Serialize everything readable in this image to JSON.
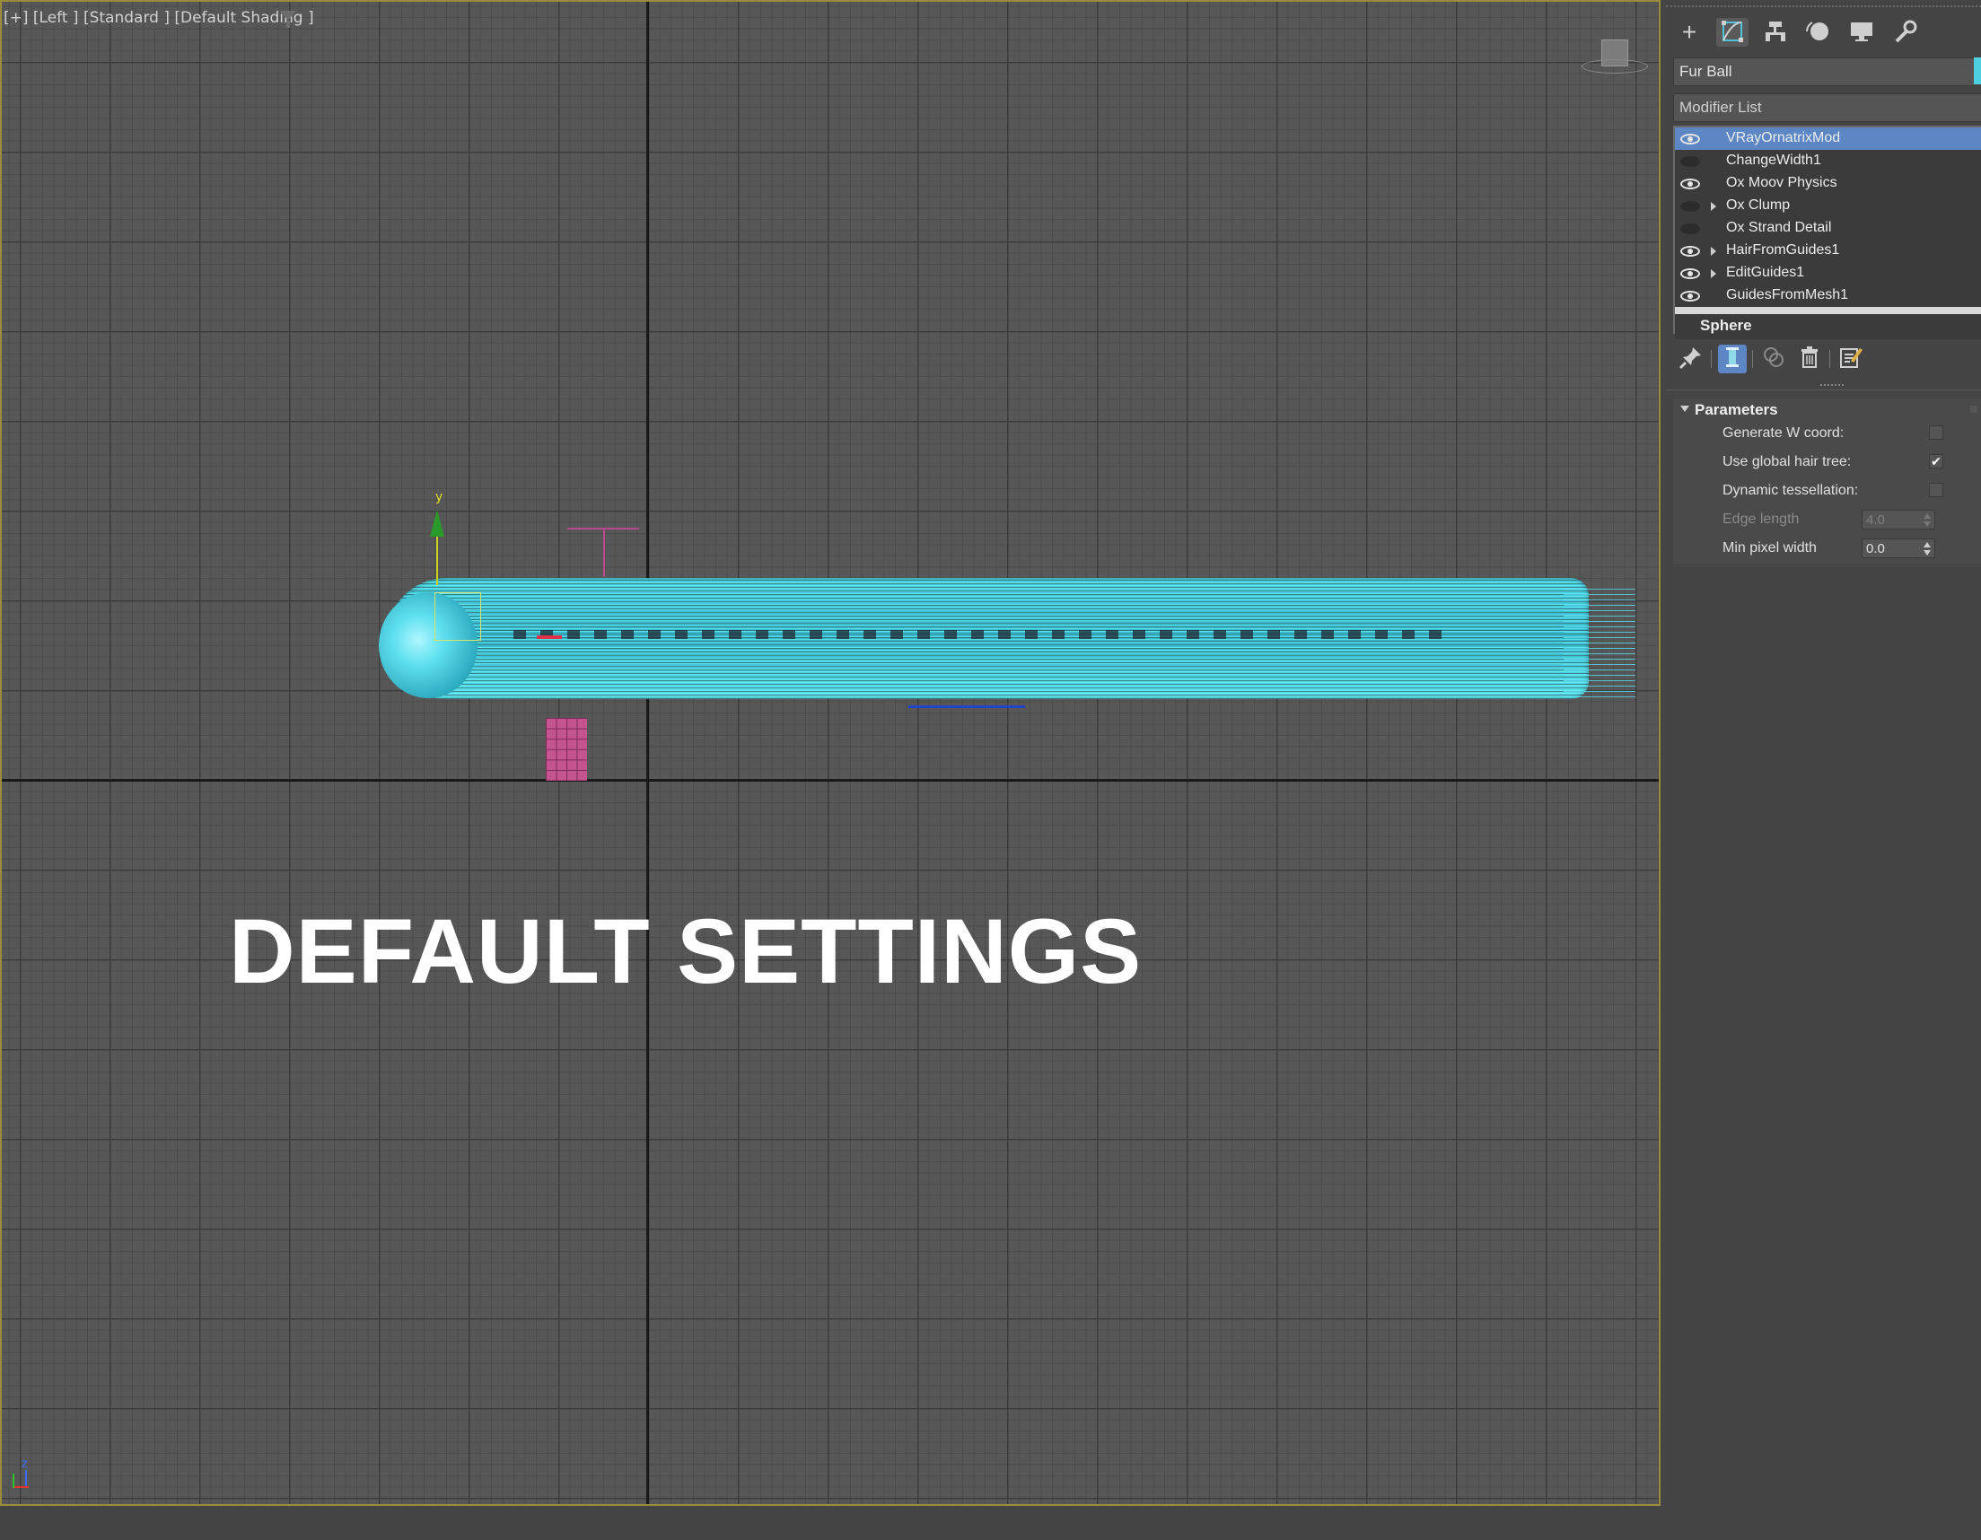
{
  "viewport": {
    "label": "[+] [Left ] [Standard ] [Default Shading ]",
    "overlay_text": "DEFAULT SETTINGS",
    "gizmo_axis_label": "y",
    "world_axis_label": "z"
  },
  "command_panel": {
    "tabs": [
      {
        "name": "create",
        "glyph": "+"
      },
      {
        "name": "modify",
        "glyph": "⬚",
        "active": true
      },
      {
        "name": "hierarchy",
        "glyph": "⊤"
      },
      {
        "name": "motion",
        "glyph": "●"
      },
      {
        "name": "display",
        "glyph": "▬"
      },
      {
        "name": "utilities",
        "glyph": "🔧"
      }
    ],
    "object_name": "Fur Ball",
    "object_color": "#4fd0e0",
    "modifier_list_label": "Modifier List",
    "stack": [
      {
        "label": "VRayOrnatrixMod",
        "eye": true,
        "expandable": false,
        "selected": true
      },
      {
        "label": "ChangeWidth1",
        "eye": false,
        "expandable": false
      },
      {
        "label": "Ox Moov Physics",
        "eye": true,
        "expandable": false
      },
      {
        "label": "Ox Clump",
        "eye": false,
        "expandable": true
      },
      {
        "label": "Ox Strand Detail",
        "eye": false,
        "expandable": false
      },
      {
        "label": "HairFromGuides1",
        "eye": true,
        "expandable": true
      },
      {
        "label": "EditGuides1",
        "eye": true,
        "expandable": true
      },
      {
        "label": "GuidesFromMesh1",
        "eye": true,
        "expandable": false
      }
    ],
    "base_object": "Sphere",
    "parameters": {
      "title": "Parameters",
      "generate_w_coord": {
        "label": "Generate W coord:",
        "checked": false
      },
      "use_global_hair_tree": {
        "label": "Use global hair tree:",
        "checked": true
      },
      "dynamic_tessellation": {
        "label": "Dynamic tessellation:",
        "checked": false
      },
      "edge_length": {
        "label": "Edge length",
        "value": "4.0",
        "enabled": false
      },
      "min_pixel_width": {
        "label": "Min pixel width",
        "value": "0.0",
        "enabled": true
      }
    },
    "accent_color": "#5c86c4"
  }
}
